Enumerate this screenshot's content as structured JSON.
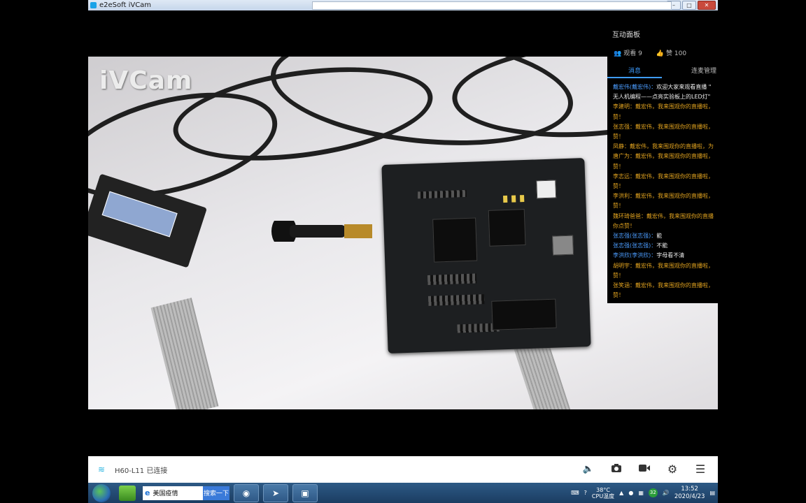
{
  "window": {
    "title": "e2eSoft iVCam"
  },
  "video": {
    "watermark": "iVCam"
  },
  "panel": {
    "title": "互动面板",
    "viewers_label": "观看 9",
    "likes_label": "赞 100",
    "tabs": [
      {
        "label": "消息"
      },
      {
        "label": "连麦管理"
      }
    ],
    "messages": [
      {
        "name": "戴宏伟(戴宏伟)：",
        "text": "欢迎大家来观看直播 \"",
        "name_color": "blue",
        "text_color": "white"
      },
      {
        "name": "",
        "text": "无人机编程——点亮实验板上的LED灯\"",
        "name_color": "",
        "text_color": "white"
      },
      {
        "name": "李建明：",
        "text": "戴宏伟，我来围观你的直播啦，",
        "name_color": "orange",
        "text_color": "orange"
      },
      {
        "name": "",
        "text": "赞！",
        "name_color": "",
        "text_color": "orange"
      },
      {
        "name": "张志强：",
        "text": "戴宏伟，我来围观你的直播啦，",
        "name_color": "orange",
        "text_color": "orange"
      },
      {
        "name": "",
        "text": "赞！",
        "name_color": "",
        "text_color": "orange"
      },
      {
        "name": "凤静：",
        "text": "戴宏伟，我来围观你的直播啦，为",
        "name_color": "orange",
        "text_color": "orange"
      },
      {
        "name": "唐广为：",
        "text": "戴宏伟，我来围观你的直播啦，",
        "name_color": "orange",
        "text_color": "orange"
      },
      {
        "name": "",
        "text": "赞！",
        "name_color": "",
        "text_color": "orange"
      },
      {
        "name": "李志远：",
        "text": "戴宏伟，我来围观你的直播啦，",
        "name_color": "orange",
        "text_color": "orange"
      },
      {
        "name": "",
        "text": "赞！",
        "name_color": "",
        "text_color": "orange"
      },
      {
        "name": "李洪利：",
        "text": "戴宏伟，我来围观你的直播啦，",
        "name_color": "orange",
        "text_color": "orange"
      },
      {
        "name": "",
        "text": "赞！",
        "name_color": "",
        "text_color": "orange"
      },
      {
        "name": "魏环琦爸爸：",
        "text": "戴宏伟，我来围观你的直播",
        "name_color": "orange",
        "text_color": "orange"
      },
      {
        "name": "",
        "text": "你点赞！",
        "name_color": "",
        "text_color": "orange"
      },
      {
        "name": "张志强(张志强)：",
        "text": "能",
        "name_color": "blue",
        "text_color": "white"
      },
      {
        "name": "张志强(张志强)：",
        "text": "不能",
        "name_color": "blue",
        "text_color": "white"
      },
      {
        "name": "李洪欣(李洪欣)：",
        "text": "字母看不清",
        "name_color": "blue",
        "text_color": "white"
      },
      {
        "name": "胡明宇：",
        "text": "戴宏伟，我来围观你的直播啦，",
        "name_color": "orange",
        "text_color": "orange"
      },
      {
        "name": "",
        "text": "赞！",
        "name_color": "",
        "text_color": "orange"
      },
      {
        "name": "张笑涵：",
        "text": "戴宏伟，我来围观你的直播啦，",
        "name_color": "orange",
        "text_color": "orange"
      },
      {
        "name": "",
        "text": "赞！",
        "name_color": "",
        "text_color": "orange"
      }
    ]
  },
  "toolbar": {
    "connection_status": "H60-L11 已连接",
    "icons": [
      "volume-icon",
      "camera-icon",
      "video-icon",
      "gear-icon",
      "menu-icon"
    ]
  },
  "taskbar": {
    "search_value": "美国疫情",
    "search_button": "搜索一下",
    "temp": "38°C",
    "cpu_label": "CPU温度",
    "tray_badge": "32",
    "time": "13:52",
    "date": "2020/4/23"
  }
}
